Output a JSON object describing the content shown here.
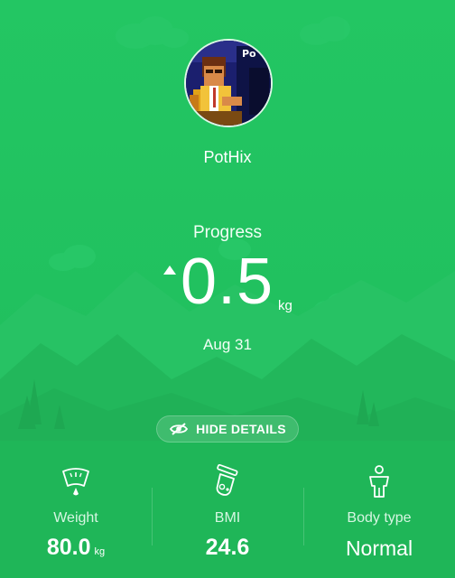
{
  "profile": {
    "username": "PotHix",
    "avatar_text": "Po"
  },
  "progress": {
    "label": "Progress",
    "direction": "up",
    "value": "0.5",
    "unit": "kg",
    "date": "Aug 31"
  },
  "details_toggle": {
    "label": "HIDE DETAILS",
    "icon": "eye-slash-icon"
  },
  "metrics": [
    {
      "icon": "scale-icon",
      "label": "Weight",
      "value": "80.0",
      "unit": "kg"
    },
    {
      "icon": "bmi-icon",
      "label": "BMI",
      "value": "24.6",
      "unit": ""
    },
    {
      "icon": "body-type-icon",
      "label": "Body type",
      "value": "Normal",
      "unit": ""
    }
  ],
  "colors": {
    "background": "#21c05f",
    "text": "#ffffff"
  }
}
